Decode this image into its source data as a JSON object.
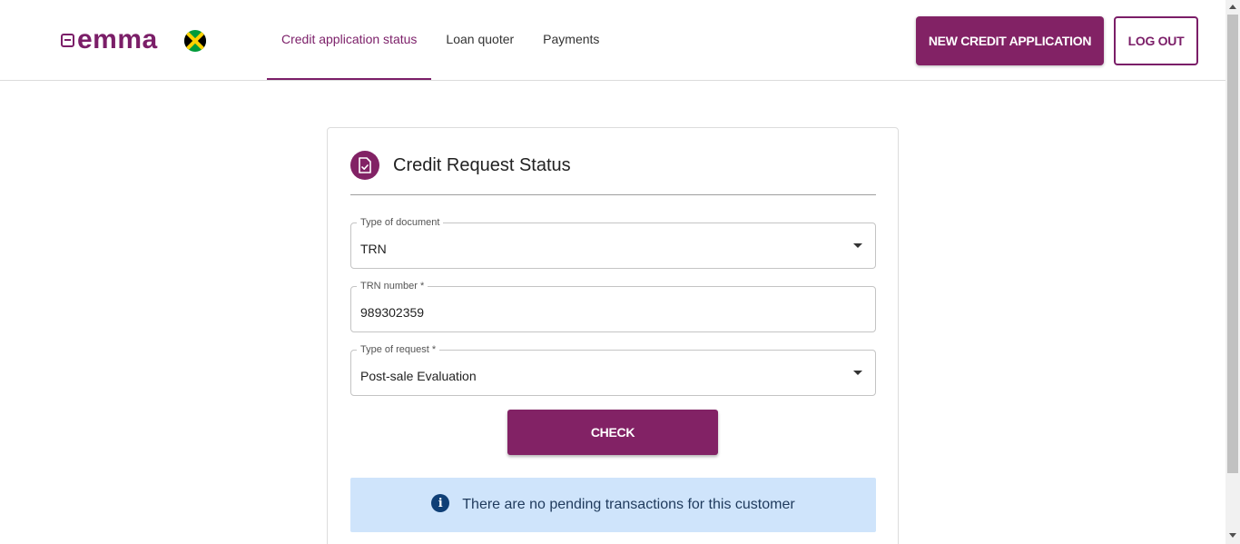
{
  "header": {
    "logo_text": "emma",
    "flag": "jamaica-flag-icon",
    "nav": [
      {
        "label": "Credit application status",
        "active": true
      },
      {
        "label": "Loan quoter",
        "active": false
      },
      {
        "label": "Payments",
        "active": false
      }
    ],
    "new_credit_label": "NEW CREDIT APPLICATION",
    "logout_label": "LOG OUT"
  },
  "card": {
    "title": "Credit Request Status",
    "icon": "document-check-icon",
    "fields": [
      {
        "label": "Type of document",
        "value": "TRN",
        "type": "select"
      },
      {
        "label": "TRN number *",
        "value": "989302359",
        "type": "input"
      },
      {
        "label": "Type of request *",
        "value": "Post-sale Evaluation",
        "type": "select"
      }
    ],
    "check_label": "CHECK",
    "info_text": "There are no pending transactions for this customer"
  },
  "colors": {
    "brand": "#822265",
    "info_bg": "#cfe4fb",
    "info_icon": "#0f3f76"
  }
}
